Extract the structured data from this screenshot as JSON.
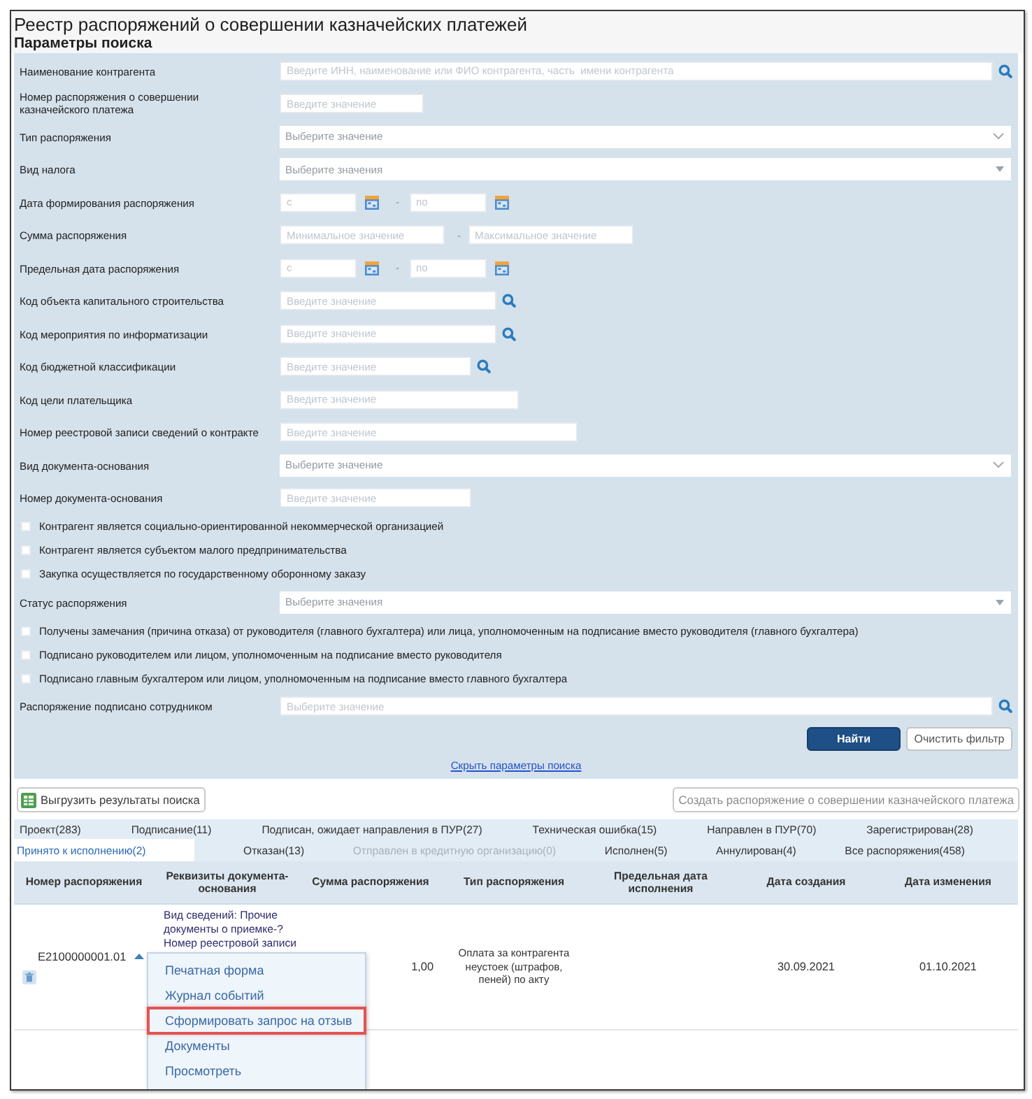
{
  "window": {
    "title": "Реестр распоряжений о совершении казначейских платежей"
  },
  "search_panel": {
    "title": "Параметры поиска",
    "fields": [
      {
        "kind": "lookup",
        "label": "Наименование контрагента",
        "placeholder": "Введите ИНН, наименование или ФИО контрагента, часть  имени контрагента"
      },
      {
        "kind": "text",
        "label": "Номер распоряжения о совершении казначейского платежа",
        "placeholder": "Введите значение"
      },
      {
        "kind": "select",
        "label": "Тип распоряжения",
        "placeholder": "Выберите значение"
      },
      {
        "kind": "multiselect",
        "label": "Вид налога",
        "placeholder": "Выберите значения"
      },
      {
        "kind": "date_range",
        "label": "Дата формирования распоряжения",
        "from_placeholder": "с",
        "separator": "-",
        "to_placeholder": "по"
      },
      {
        "kind": "number_range",
        "label": "Сумма распоряжения",
        "from_placeholder": "Минимальное значение",
        "separator": "-",
        "to_placeholder": "Максимальное значение"
      },
      {
        "kind": "date_range",
        "label": "Предельная дата распоряжения",
        "from_placeholder": "с",
        "separator": "-",
        "to_placeholder": "по"
      },
      {
        "kind": "lookup",
        "label": "Код объекта капитального строительства",
        "placeholder": "Введите значение"
      },
      {
        "kind": "lookup",
        "label": "Код мероприятия по информатизации",
        "placeholder": "Введите значение"
      },
      {
        "kind": "lookup",
        "label": "Код бюджетной классификации",
        "placeholder": "Введите значение"
      },
      {
        "kind": "text",
        "label": "Код цели плательщика",
        "placeholder": "Введите значение"
      },
      {
        "kind": "text",
        "label": "Номер реестровой записи сведений о контракте",
        "placeholder": "Введите значение"
      },
      {
        "kind": "select",
        "label": "Вид документа-основания",
        "placeholder": "Выберите значение"
      },
      {
        "kind": "text",
        "label": "Номер документа-основания",
        "placeholder": "Введите значение"
      },
      {
        "kind": "checkbox",
        "label": "Контрагент является социально-ориентированной некоммерческой организацией",
        "checked": false
      },
      {
        "kind": "checkbox",
        "label": "Контрагент является субъектом малого предпринимательства",
        "checked": false
      },
      {
        "kind": "checkbox",
        "label": "Закупка осуществляется по государственному оборонному заказу",
        "checked": false
      },
      {
        "kind": "multiselect",
        "label": "Статус распоряжения",
        "placeholder": "Выберите значения"
      },
      {
        "kind": "checkbox",
        "label": "Получены замечания (причина отказа) от руководителя (главного бухгалтера) или лица, уполномоченным на подписание вместо руководителя (главного бухгалтера)",
        "checked": false
      },
      {
        "kind": "checkbox",
        "label": "Подписано руководителем или лицом, уполномоченным на подписание вместо руководителя",
        "checked": false
      },
      {
        "kind": "checkbox",
        "label": "Подписано главным бухгалтером или лицом, уполномоченным на подписание вместо главного бухгалтера",
        "checked": false
      },
      {
        "kind": "lookup",
        "label": "Распоряжение подписано сотрудником",
        "placeholder": "Выберите значение"
      }
    ],
    "buttons": [
      {
        "kind": "primary",
        "label": "Найти"
      },
      {
        "kind": "secondary",
        "label": "Очистить фильтр"
      }
    ],
    "toggle_link": "Скрыть параметры поиска"
  },
  "toolbar": {
    "export_button": "Выгрузить результаты поиска",
    "create_button": "Создать распоряжение о совершении казначейского платежа"
  },
  "status_tabs": [
    {
      "tabs": [
        {
          "label": "Проект(283)",
          "selected": false,
          "disabled": false
        },
        {
          "label": "Подписание(11)",
          "selected": false,
          "disabled": false
        },
        {
          "label": "Подписан, ожидает направления в ПУР(27)",
          "selected": false,
          "disabled": false
        },
        {
          "label": "Техническая ошибка(15)",
          "selected": false,
          "disabled": false
        },
        {
          "label": "Направлен в ПУР(70)",
          "selected": false,
          "disabled": false
        },
        {
          "label": "Зарегистрирован(28)",
          "selected": false,
          "disabled": false
        }
      ]
    },
    {
      "tabs": [
        {
          "label": "Принято к исполнению(2)",
          "selected": true,
          "disabled": false
        },
        {
          "label": "Отказан(13)",
          "selected": false,
          "disabled": false
        },
        {
          "label": "Отправлен в кредитную организацию(0)",
          "selected": false,
          "disabled": true
        },
        {
          "label": "Исполнен(5)",
          "selected": false,
          "disabled": false
        },
        {
          "label": "Аннулирован(4)",
          "selected": false,
          "disabled": false
        },
        {
          "label": "Все распоряжения(458)",
          "selected": false,
          "disabled": false
        }
      ]
    }
  ],
  "table": {
    "columns": [
      "Номер распоряжения",
      "Реквизиты документа-основания",
      "Сумма распоряжения",
      "Тип распоряжения",
      "Предельная дата исполнения",
      "Дата создания",
      "Дата изменения"
    ],
    "rows": [
      {
        "number": "E2100000001.01",
        "expanded": true,
        "basis_document": "Вид сведений: Прочие документы о приемке-? Номер реестровой записи",
        "amount": "1,00",
        "order_type": "Оплата за контрагента неустоек (штрафов, пеней) по акту",
        "created": "30.09.2021",
        "modified": "01.10.2021"
      }
    ]
  },
  "context_menu": {
    "items": [
      {
        "label": "Печатная форма",
        "highlighted": false
      },
      {
        "label": "Журнал событий",
        "highlighted": false
      },
      {
        "label": "Сформировать запрос на отзыв",
        "highlighted": true
      },
      {
        "label": "Документы",
        "highlighted": false
      },
      {
        "label": "Просмотреть",
        "highlighted": false
      }
    ]
  }
}
